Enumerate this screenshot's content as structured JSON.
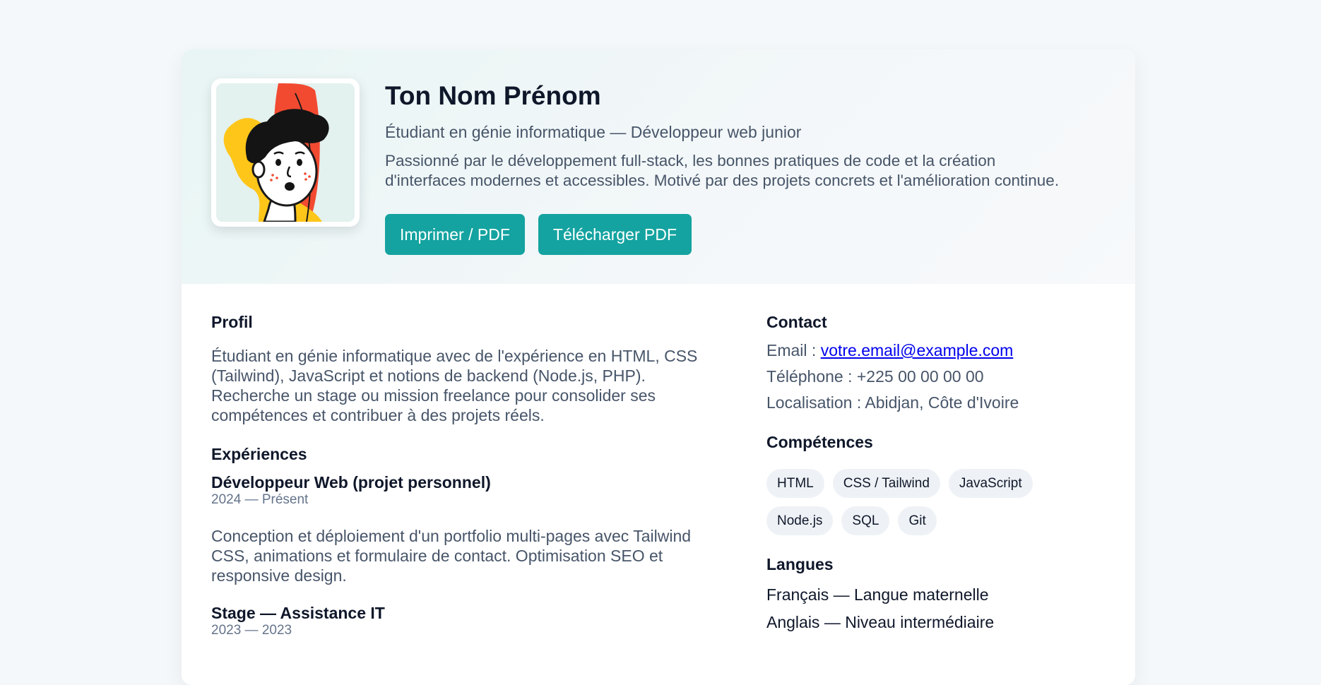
{
  "header": {
    "name": "Ton Nom Prénom",
    "subtitle": "Étudiant en génie informatique — Développeur web junior",
    "intro_line1": "Passionné par le développement full-stack, les bonnes pratiques de code et la création",
    "intro_line2": "d'interfaces modernes et accessibles. Motivé par des projets concrets et l'amélioration continue.",
    "buttons": {
      "print": "Imprimer / PDF",
      "download": "Télécharger PDF"
    }
  },
  "profile": {
    "title": "Profil",
    "lines": [
      "Étudiant en génie informatique avec de l'expérience en HTML, CSS",
      "(Tailwind), JavaScript et notions de backend (Node.js, PHP).",
      "Recherche un stage ou mission freelance pour consolider ses",
      "compétences et contribuer à des projets réels."
    ]
  },
  "experiences": {
    "title": "Expériences",
    "items": [
      {
        "title": "Développeur Web (projet personnel)",
        "date": "2024 — Présent",
        "lines": [
          "Conception et déploiement d'un portfolio multi-pages avec Tailwind",
          "CSS, animations et formulaire de contact. Optimisation SEO et",
          "responsive design."
        ]
      },
      {
        "title": "Stage — Assistance IT",
        "date": "2023 — 2023"
      }
    ]
  },
  "contact": {
    "title": "Contact",
    "email_label": "Email : ",
    "email": "votre.email@example.com",
    "phone": "Téléphone : +225 00 00 00 00",
    "location": "Localisation : Abidjan, Côte d'Ivoire"
  },
  "skills": {
    "title": "Compétences",
    "tags": [
      "HTML",
      "CSS / Tailwind",
      "JavaScript",
      "Node.js",
      "SQL",
      "Git"
    ]
  },
  "languages": {
    "title": "Langues",
    "items": [
      "Français — Langue maternelle",
      "Anglais — Niveau intermédiaire"
    ]
  },
  "colors": {
    "accent": "#14a3a0",
    "page_bg": "#f4f8fb",
    "text_dark": "#0f172a",
    "text_muted": "#475569",
    "tag_bg": "#eef2f6",
    "link": "#0000ee"
  },
  "avatar": {
    "icon": "cartoon-avatar-illustration"
  }
}
